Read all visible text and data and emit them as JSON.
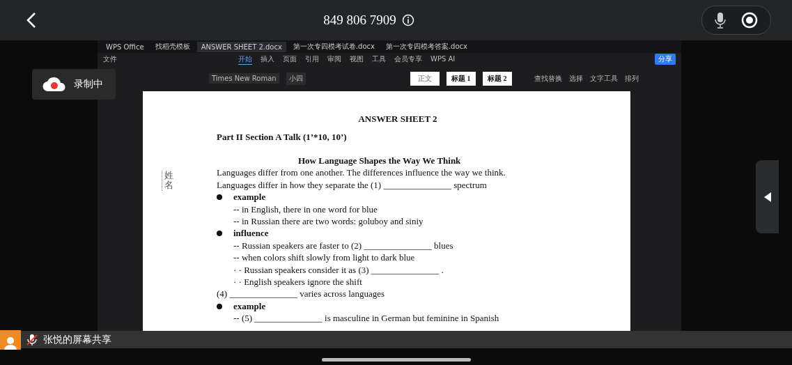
{
  "call_bar": {
    "phone": "849 806 7909"
  },
  "recording": {
    "label": "录制中"
  },
  "wps": {
    "tabs": [
      {
        "label": "WPS Office",
        "selected": false
      },
      {
        "label": "找稻壳模板",
        "selected": false
      },
      {
        "label": "ANSWER SHEET 2.docx",
        "selected": true
      },
      {
        "label": "第一次专四模考试卷.docx",
        "selected": false
      },
      {
        "label": "第一次专四模考答案.docx",
        "selected": false
      }
    ],
    "file_menu": "文件",
    "menu": [
      {
        "label": "开始",
        "selected": true
      },
      {
        "label": "插入",
        "selected": false
      },
      {
        "label": "页面",
        "selected": false
      },
      {
        "label": "引用",
        "selected": false
      },
      {
        "label": "审阅",
        "selected": false
      },
      {
        "label": "视图",
        "selected": false
      },
      {
        "label": "工具",
        "selected": false
      },
      {
        "label": "会员专享",
        "selected": false
      },
      {
        "label": "WPS AI",
        "selected": false
      }
    ],
    "share": "分享",
    "font": "Times New Roman",
    "size": "小四",
    "styles": [
      "正文",
      "标题 1",
      "标题 2"
    ],
    "tools": [
      "查找替换",
      "选择",
      "文字工具",
      "排列"
    ]
  },
  "document": {
    "margin_label": "姓名",
    "title": "ANSWER SHEET 2",
    "section": "Part II Section A Talk (1’*10, 10’)",
    "lines": [
      {
        "kind": "heading",
        "text": "How Language Shapes the Way We Think"
      },
      {
        "kind": "plain",
        "text": "Languages differ from one another. The differences influence the way we think."
      },
      {
        "kind": "plain",
        "text": "Languages differ in how they separate the (1) _______________ spectrum"
      },
      {
        "kind": "bullet",
        "text": "example"
      },
      {
        "kind": "sub",
        "text": "-- in English, there in one word for blue"
      },
      {
        "kind": "sub",
        "text": "-- in Russian there are two words: goluboy and siniy"
      },
      {
        "kind": "bullet",
        "text": "influence"
      },
      {
        "kind": "sub",
        "text": "-- Russian speakers are faster to (2) _______________ blues"
      },
      {
        "kind": "sub",
        "text": "-- when colors shift slowly from light to dark blue"
      },
      {
        "kind": "sub",
        "text": "· · Russian speakers consider it as (3) _______________ ."
      },
      {
        "kind": "sub",
        "text": "· · English speakers ignore the shift"
      },
      {
        "kind": "plain",
        "text": "(4) _______________ varies across languages"
      },
      {
        "kind": "bullet",
        "text": "example"
      },
      {
        "kind": "sub",
        "text": "-- (5) _______________ is masculine in German but feminine in Spanish"
      }
    ]
  },
  "share_bar": {
    "label": "张悦的屏幕共享"
  }
}
